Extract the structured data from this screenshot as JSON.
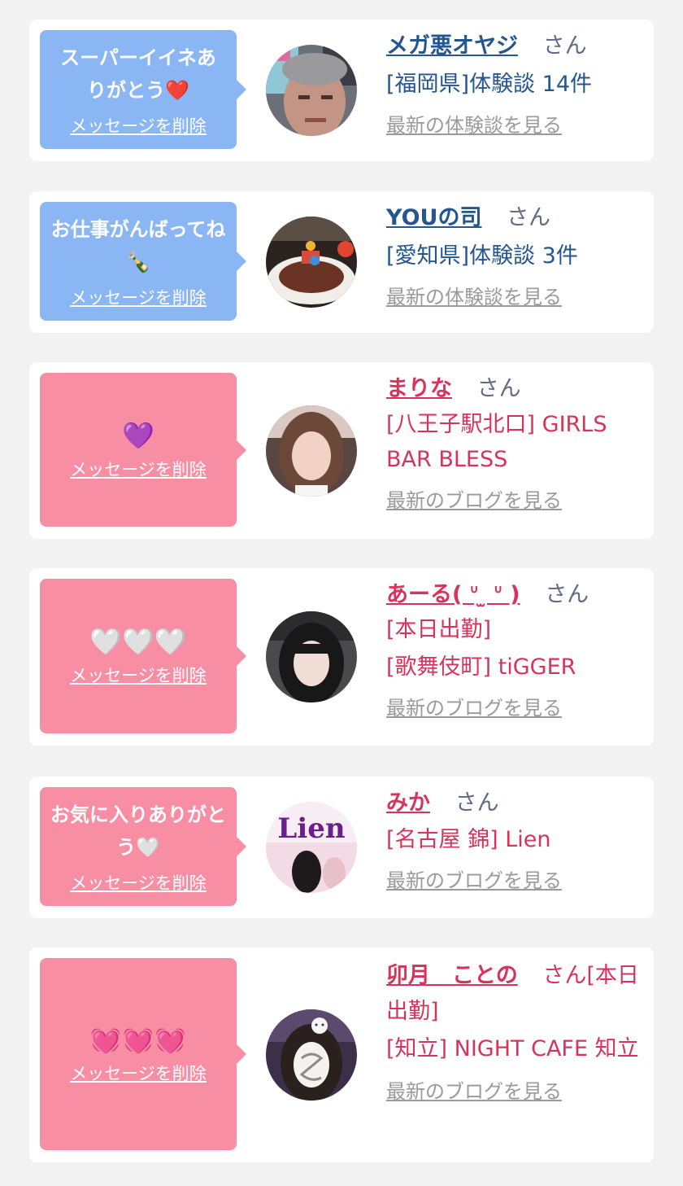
{
  "colors": {
    "bubble_blue": "#8ab6f3",
    "bubble_pink": "#f78ea3",
    "text_blue": "#24568f",
    "text_pink": "#d7335c",
    "link_gray": "#9a9a9a"
  },
  "cards": [
    {
      "message": "スーパーイイネありがとう❤️",
      "delete_label": "メッセージを削除",
      "name": "メガ悪オヤジ",
      "honorific": "さん",
      "details": [
        "[福岡県]体験談 14件"
      ],
      "latest_link": "最新の体験談を見る"
    },
    {
      "message": "お仕事がんばってね🍾",
      "delete_label": "メッセージを削除",
      "name": "YOUの司",
      "honorific": "さん",
      "details": [
        "[愛知県]体験談 3件"
      ],
      "latest_link": "最新の体験談を見る"
    },
    {
      "message": "💜",
      "delete_label": "メッセージを削除",
      "name": "まりな",
      "honorific": "さん",
      "details": [
        "[八王子駅北口] GIRLS BAR BLESS"
      ],
      "latest_link": "最新のブログを見る"
    },
    {
      "message": "🤍🤍🤍",
      "delete_label": "メッセージを削除",
      "name": "あーる( ᐡ ̫ ᐡ )",
      "honorific": "さん",
      "details": [
        "[本日出勤]",
        "[歌舞伎町] tiGGER"
      ],
      "latest_link": "最新のブログを見る"
    },
    {
      "message": "お気に入りありがとう🤍",
      "delete_label": "メッセージを削除",
      "name": "みか",
      "honorific": "さん",
      "details": [
        "[名古屋 錦] Lien"
      ],
      "latest_link": "最新のブログを見る"
    },
    {
      "message": "💓💓💓",
      "delete_label": "メッセージを削除",
      "name": "卯月　ことの",
      "honorific": "さん[本日出勤]",
      "details": [
        "[知立] NIGHT CAFE 知立"
      ],
      "latest_link": "最新のブログを見る"
    }
  ]
}
